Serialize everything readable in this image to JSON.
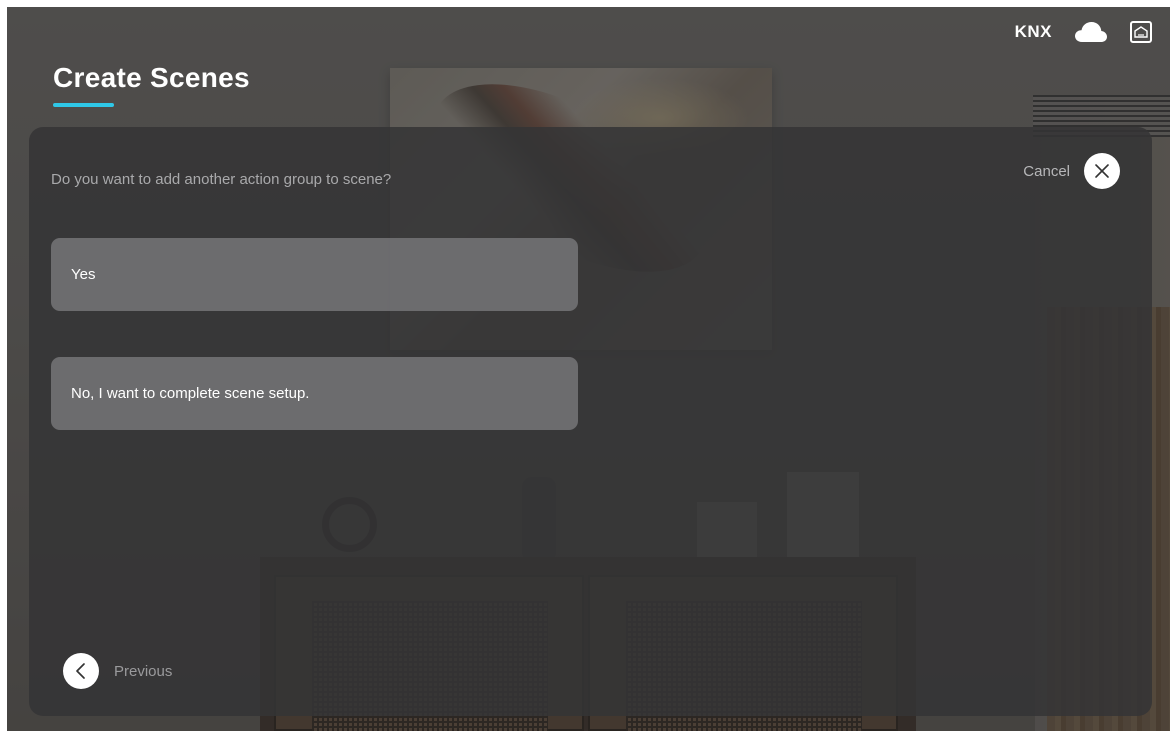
{
  "status_bar": {
    "protocol_label": "KNX",
    "icons": [
      "cloud-icon",
      "home-icon"
    ]
  },
  "page": {
    "title": "Create Scenes",
    "accent_color": "#2fc8e8"
  },
  "dialog": {
    "prompt": "Do you want to add another action group to scene?",
    "cancel_label": "Cancel",
    "options": [
      {
        "label": "Yes"
      },
      {
        "label": "No, I want to complete scene setup."
      }
    ],
    "previous_label": "Previous"
  }
}
